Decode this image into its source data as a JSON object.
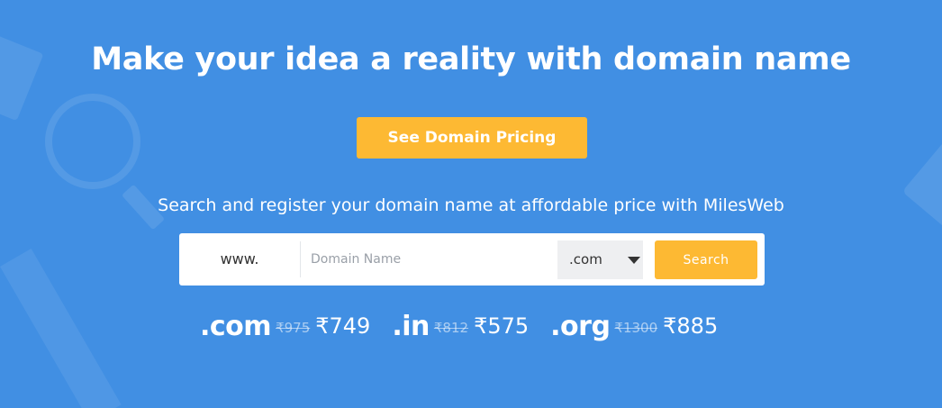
{
  "hero": {
    "headline": "Make your idea a reality with domain name",
    "pricing_button": "See Domain Pricing",
    "subtitle": "Search and register your domain name at affordable price with MilesWeb"
  },
  "search": {
    "prefix": "www.",
    "placeholder": "Domain Name",
    "value": "",
    "tld_selected": ".com",
    "button_label": "Search"
  },
  "prices": [
    {
      "ext": ".com",
      "old": "₹975",
      "new": "₹749"
    },
    {
      "ext": ".in",
      "old": "₹812",
      "new": "₹575"
    },
    {
      "ext": ".org",
      "old": "₹1300",
      "new": "₹885"
    }
  ],
  "colors": {
    "background": "#418fe3",
    "accent": "#fdb933",
    "text": "#ffffff"
  },
  "icons": {
    "dropdown": "chevron-down-icon"
  }
}
